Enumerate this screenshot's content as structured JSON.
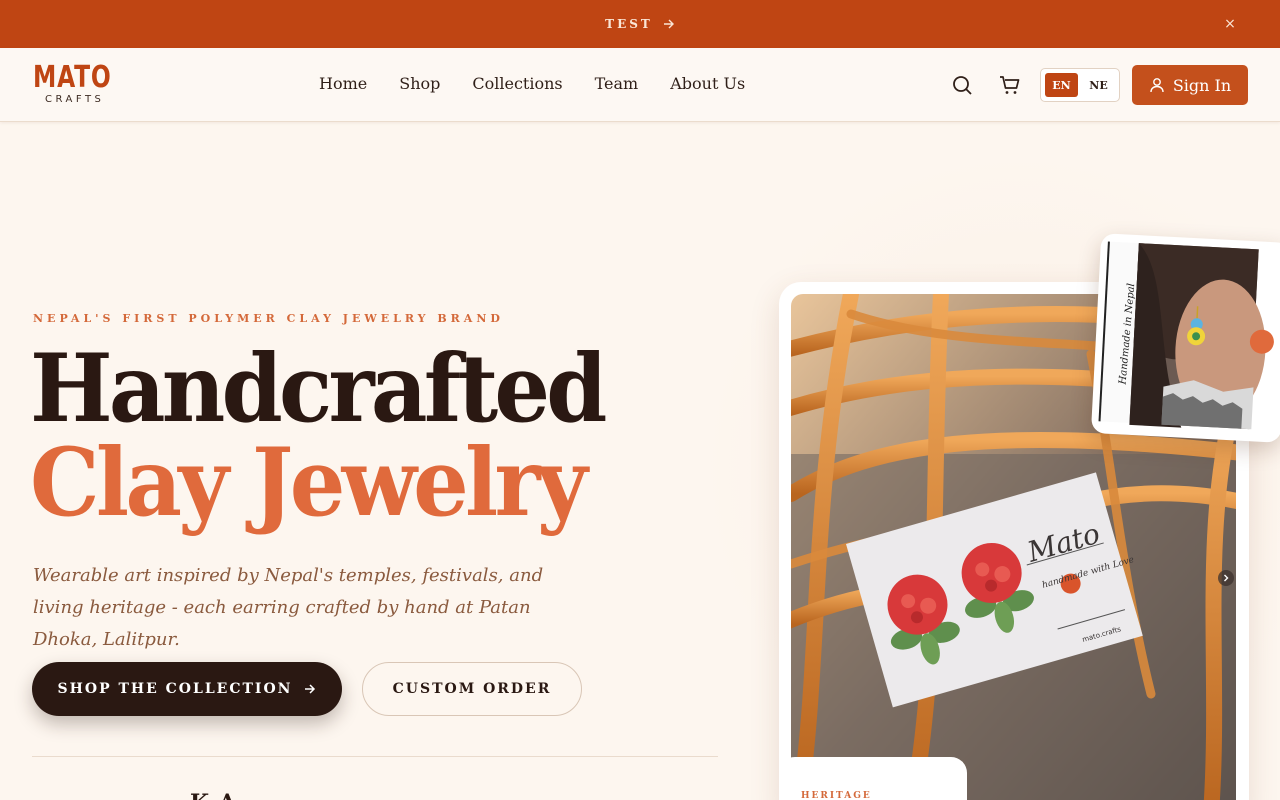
{
  "announcement": {
    "text": "TEST",
    "close_label": "×"
  },
  "logo": {
    "main": "MATO",
    "sub": "CRAFTS"
  },
  "nav": {
    "items": [
      "Home",
      "Shop",
      "Collections",
      "Team",
      "About Us"
    ]
  },
  "language": {
    "en": "EN",
    "ne": "NE",
    "selected": "EN"
  },
  "header": {
    "signin_label": "Sign In",
    "search_icon": "search-icon",
    "cart_icon": "cart-icon",
    "user_icon": "user-icon"
  },
  "hero": {
    "kicker": "NEPAL'S FIRST POLYMER CLAY JEWELRY BRAND",
    "title_line1": "Handcrafted",
    "title_line2": "Clay Jewelry",
    "subtext": "Wearable art inspired by Nepal's temples, festivals, and living heritage - each earring crafted by hand at Patan Dhoka, Lalitpur.",
    "primary_button": "SHOP THE COLLECTION",
    "secondary_button": "CUSTOM ORDER",
    "peek_text": "K       A"
  },
  "image_card": {
    "badge": "HERITAGE",
    "thumb_caption": "Handmade in Nepal",
    "card_brand": "Mato",
    "card_tagline": "handmade with Love",
    "card_handle": "mato.crafts"
  },
  "colors": {
    "accent": "#bf4513",
    "primary_text": "#2a1812",
    "highlight": "#e06a3c",
    "background": "#fdf6ef"
  }
}
